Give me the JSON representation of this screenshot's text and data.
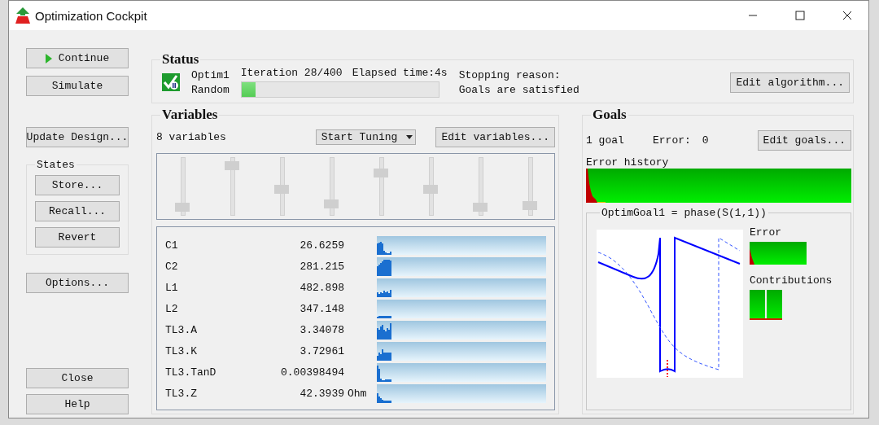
{
  "window": {
    "title": "Optimization Cockpit"
  },
  "side_buttons": [
    {
      "label": "Continue",
      "kind": "play"
    },
    {
      "label": "Simulate",
      "kind": "plain"
    },
    {
      "label": "Update Design...",
      "kind": "plain"
    }
  ],
  "states": {
    "title": "States",
    "buttons": [
      "Store...",
      "Recall...",
      "Revert"
    ]
  },
  "options_button": "Options...",
  "bottom_buttons": [
    "Close",
    "Help"
  ],
  "status": {
    "title": "Status",
    "name": "Optim1",
    "method": "Random",
    "iteration": "Iteration 28/400",
    "elapsed": "Elapsed time:4s",
    "level": 0.07,
    "stop_label": "Stopping reason:",
    "stop_reason": "Goals are satisfied",
    "edit_button": "Edit algorithm..."
  },
  "variables": {
    "title": "Variables",
    "count": "8 variables",
    "tuning_button": "Start Tuning",
    "edit_button": "Edit variables...",
    "sliders": [
      {
        "level": 0.08
      },
      {
        "level": 0.92
      },
      {
        "level": 0.45
      },
      {
        "level": 0.15
      },
      {
        "level": 0.77
      },
      {
        "level": 0.45
      },
      {
        "level": 0.08
      },
      {
        "level": 0.11
      }
    ],
    "rows": [
      {
        "name": "C1",
        "value": "26.6259"
      },
      {
        "name": "C2",
        "value": "281.215"
      },
      {
        "name": "L1",
        "value": "482.898"
      },
      {
        "name": "L2",
        "value": "347.148"
      },
      {
        "name": "TL3.A",
        "value": "3.34078"
      },
      {
        "name": "TL3.K",
        "value": "3.72961"
      },
      {
        "name": "TL3.TanD",
        "value": "0.00398494"
      },
      {
        "name": "TL3.Z",
        "value": "42.3939",
        "unit": "Ohm"
      }
    ]
  },
  "goals": {
    "title": "Goals",
    "count": "1 goal",
    "error_label": "Error:",
    "error_value": "0",
    "edit_button": "Edit goals...",
    "history_label": "Error history",
    "goal_title": "OptimGoal1 = phase(S(1,1))",
    "goal_error_label": "Error",
    "contributions_label": "Contributions"
  }
}
